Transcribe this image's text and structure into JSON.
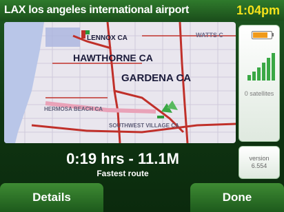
{
  "header": {
    "title": "LAX los angeles international airport",
    "clock": "1:04pm"
  },
  "map": {
    "labels": {
      "lennox": "LENNOX CA",
      "watts": "WATTS C",
      "hawthorne": "HAWTHORNE CA",
      "gardena": "GARDENA CA",
      "hermosa": "HERMOSA BEACH CA",
      "southwest": "SOUTHWEST VILLAGE CA"
    }
  },
  "status": {
    "battery_level": 0.8,
    "satellites": "0 satellites",
    "version_label": "version",
    "version_number": "6.554"
  },
  "route": {
    "summary": "0:19 hrs - 11.1M",
    "type": "Fastest route"
  },
  "buttons": {
    "details": "Details",
    "done": "Done"
  },
  "colors": {
    "accent_green": "#2f7a2c",
    "clock_yellow": "#f5e21a",
    "route_red": "#c0302a",
    "battery_orange": "#f09a1b"
  }
}
